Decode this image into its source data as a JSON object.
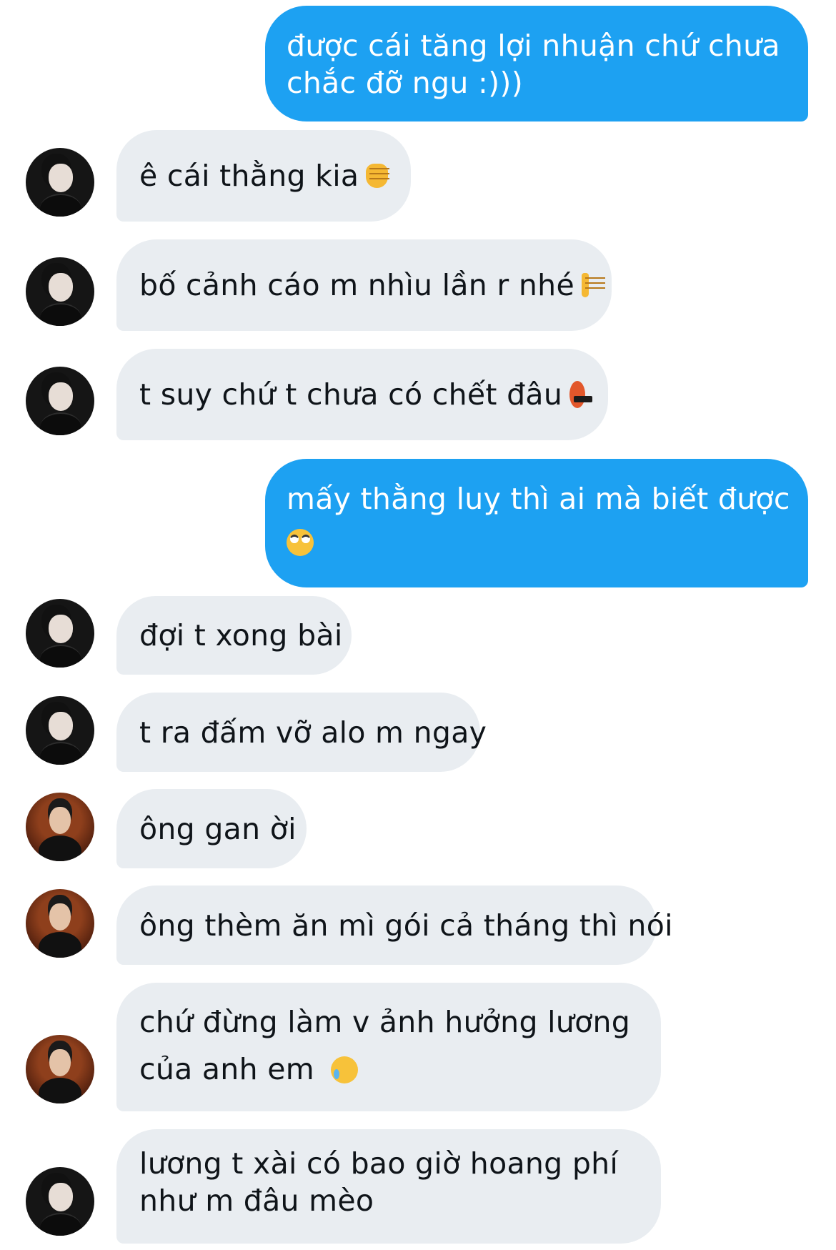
{
  "messages": [
    {
      "direction": "outgoing",
      "lines": [
        "được cái tăng lợi nhuận chứ chưa",
        "chắc đỡ ngu :)))"
      ]
    },
    {
      "direction": "incoming",
      "avatar": "user-a-avatar",
      "lines": [
        "ê cái thằng kia"
      ],
      "emoji": "backhand-index-pointing-left-emoji"
    },
    {
      "direction": "incoming",
      "avatar": "user-a-avatar",
      "lines": [
        "bố cảnh cáo m nhìu lần r nhé"
      ],
      "emoji": "oncoming-fist-emoji"
    },
    {
      "direction": "incoming",
      "avatar": "user-a-avatar",
      "lines": [
        "t suy chứ t chưa có chết đâu"
      ],
      "emoji": "face-with-symbols-on-mouth-emoji"
    },
    {
      "direction": "outgoing",
      "lines": [
        "mấy thằng luỵ thì ai mà biết được"
      ],
      "emoji": "face-with-rolling-eyes-emoji"
    },
    {
      "direction": "incoming",
      "avatar": "user-a-avatar",
      "lines": [
        "đợi t xong bài"
      ]
    },
    {
      "direction": "incoming",
      "avatar": "user-a-avatar",
      "lines": [
        "t ra đấm vỡ alo m ngay"
      ]
    },
    {
      "direction": "incoming",
      "avatar": "user-b-avatar",
      "lines": [
        "ông gan ời"
      ]
    },
    {
      "direction": "incoming",
      "avatar": "user-b-avatar",
      "lines": [
        "ông thèm ăn mì gói cả tháng thì nói"
      ]
    },
    {
      "direction": "incoming",
      "avatar": "user-b-avatar",
      "lines": [
        "chứ đừng làm v ảnh hưởng lương",
        "của anh em"
      ],
      "emoji": "crying-face-emoji"
    },
    {
      "direction": "incoming",
      "avatar": "user-a-avatar",
      "lines": [
        "lương t xài có bao giờ hoang phí",
        "như m đâu mèo"
      ]
    }
  ],
  "colors": {
    "outgoing_bubble": "#1da1f2",
    "incoming_bubble": "#e9edf1",
    "outgoing_text": "#ffffff",
    "incoming_text": "#0f1419"
  }
}
